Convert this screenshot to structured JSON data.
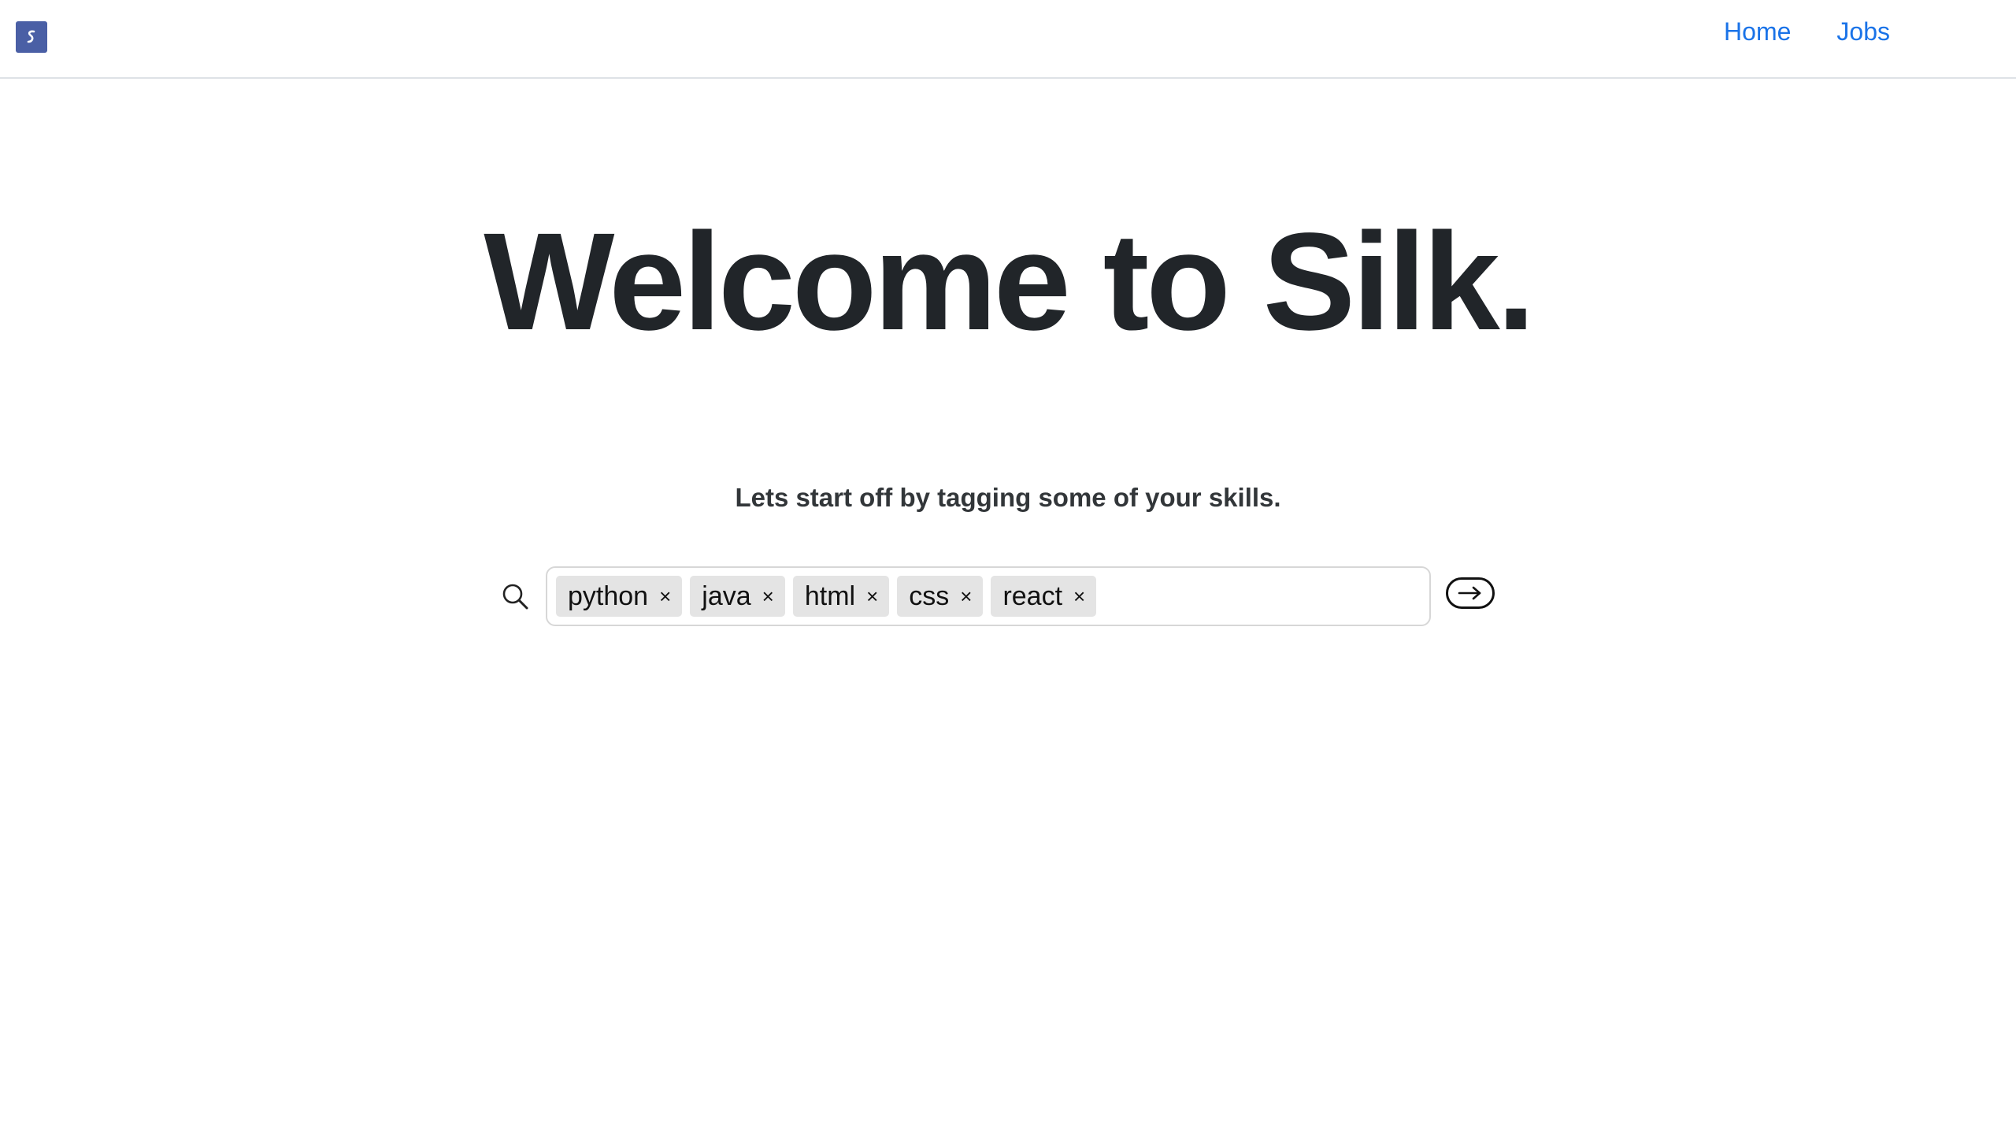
{
  "app": {
    "logo_icon": "silk-logo-icon",
    "brand_color": "#4a5fa5",
    "link_color": "#1a73e8"
  },
  "nav": {
    "items": [
      {
        "label": "Home"
      },
      {
        "label": "Jobs"
      }
    ]
  },
  "hero": {
    "title": "Welcome to Silk.",
    "subtitle": "Lets start off by tagging some of your skills."
  },
  "skills_input": {
    "search_icon": "search-icon",
    "value": "",
    "tags": [
      {
        "label": "python",
        "remove": "×"
      },
      {
        "label": "java",
        "remove": "×"
      },
      {
        "label": "html",
        "remove": "×"
      },
      {
        "label": "css",
        "remove": "×"
      },
      {
        "label": "react",
        "remove": "×"
      }
    ],
    "submit_icon": "arrow-right-icon"
  }
}
